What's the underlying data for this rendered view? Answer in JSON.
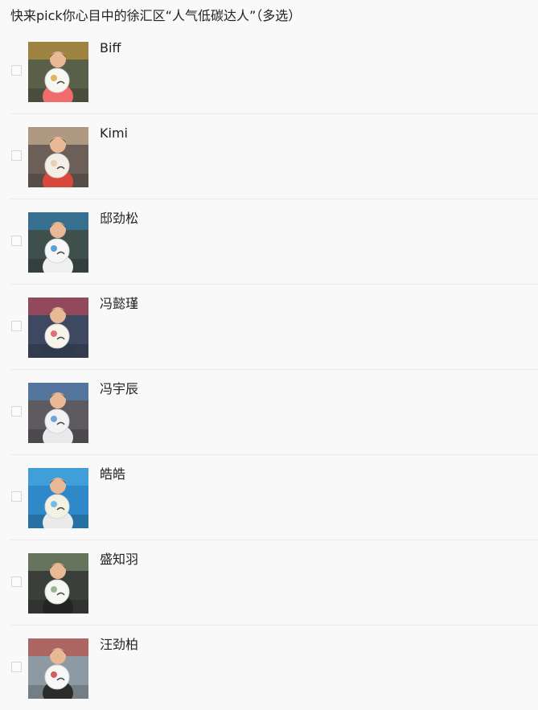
{
  "question": {
    "title": "快来pick你心目中的徐汇区“人气低碳达人”（多选）"
  },
  "options": [
    {
      "label": "Biff",
      "checked": false,
      "photo": {
        "bg": "#5a5f4a",
        "accent": "#d8a23a",
        "shirt": "#f26b6b",
        "plate": "#f7f7f2"
      }
    },
    {
      "label": "Kimi",
      "checked": false,
      "photo": {
        "bg": "#6b5f58",
        "accent": "#e8c7a6",
        "shirt": "#d9493b",
        "plate": "#f4efe6"
      }
    },
    {
      "label": "邸劲松",
      "checked": false,
      "photo": {
        "bg": "#3f4f4c",
        "accent": "#2f8bc7",
        "shirt": "#f0f0f0",
        "plate": "#f6f6f6"
      }
    },
    {
      "label": "冯懿瑾",
      "checked": false,
      "photo": {
        "bg": "#3f4861",
        "accent": "#d94b5a",
        "shirt": "#2f3a4d",
        "plate": "#f7f4ec"
      }
    },
    {
      "label": "冯宇辰",
      "checked": false,
      "photo": {
        "bg": "#5d5a60",
        "accent": "#4c8ed1",
        "shirt": "#e9e9ec",
        "plate": "#f2f2f2"
      }
    },
    {
      "label": "皓皓",
      "checked": false,
      "photo": {
        "bg": "#2f89c9",
        "accent": "#4fb0e6",
        "shirt": "#eaeaea",
        "plate": "#f5f1e2"
      }
    },
    {
      "label": "盛知羽",
      "checked": false,
      "photo": {
        "bg": "#3b3f3a",
        "accent": "#8aa07a",
        "shirt": "#222426",
        "plate": "#f6f6f3"
      }
    },
    {
      "label": "汪劲柏",
      "checked": false,
      "photo": {
        "bg": "#8e9aa3",
        "accent": "#c23b2f",
        "shirt": "#2b2b2b",
        "plate": "#f7f7f7"
      }
    }
  ]
}
